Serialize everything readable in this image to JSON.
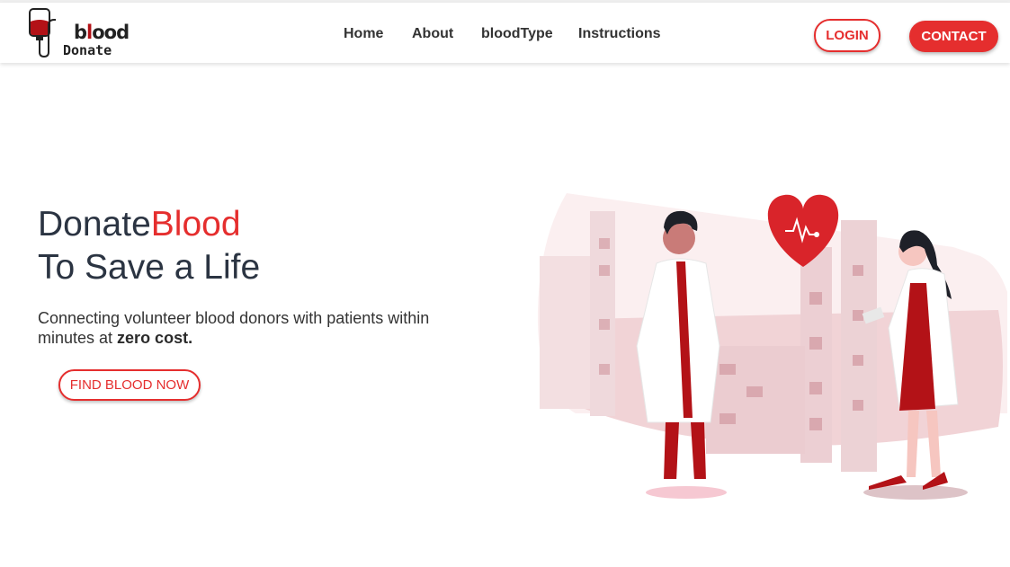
{
  "brand": {
    "logo_part1": "b",
    "logo_part2": "l",
    "logo_part3": "ood",
    "logo_sub": "Donate"
  },
  "nav": {
    "items": [
      "Home",
      "About",
      "bloodType",
      "Instructions"
    ]
  },
  "header": {
    "login_label": "LOGIN",
    "contact_label": "CONTACT"
  },
  "hero": {
    "title_part1": "Donate",
    "title_accent": "Blood",
    "title_line2": "To Save a Life",
    "subtitle_text": "Connecting volunteer blood donors with patients within minutes at ",
    "subtitle_bold": "zero cost.",
    "cta_label": "FIND BLOOD NOW"
  },
  "colors": {
    "accent": "#e52e2e",
    "dark_text": "#2b3442",
    "blood_dark": "#b31217",
    "pink_bg": "#f3d9dc"
  },
  "icons": [
    "blood-bag-icon",
    "heart-pulse-icon"
  ]
}
